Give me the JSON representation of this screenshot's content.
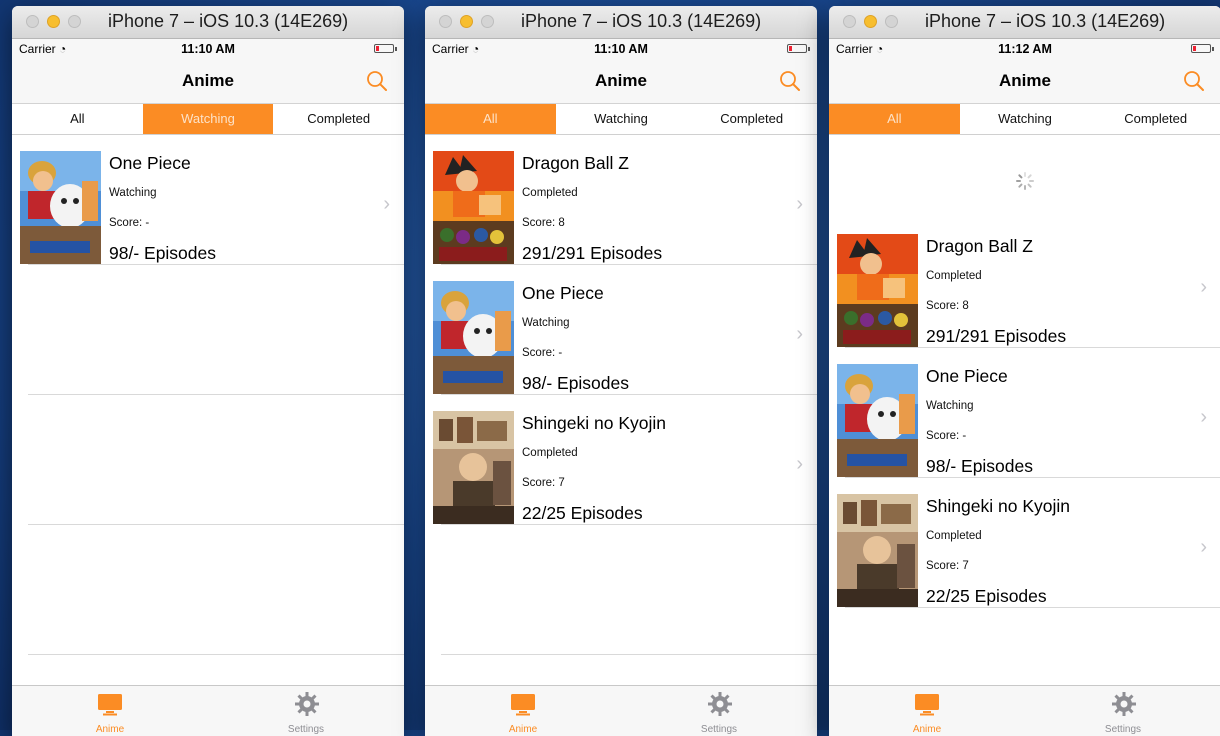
{
  "colors": {
    "accent": "#fb8c24",
    "chevron": "#c7c7cc"
  },
  "windows": [
    {
      "title": "iPhone 7 – iOS 10.3 (14E269)",
      "status": {
        "carrier": "Carrier",
        "time": "11:10 AM"
      },
      "nav_title": "Anime",
      "tabs": [
        "All",
        "Watching",
        "Completed"
      ],
      "active_tab": "Watching",
      "items": [
        {
          "title": "One Piece",
          "status": "Watching",
          "score": "Score: -",
          "episodes": "98/- Episodes",
          "cover": "one-piece"
        }
      ],
      "tabbar": {
        "anime": "Anime",
        "settings": "Settings"
      }
    },
    {
      "title": "iPhone 7 – iOS 10.3 (14E269)",
      "status": {
        "carrier": "Carrier",
        "time": "11:10 AM"
      },
      "nav_title": "Anime",
      "tabs": [
        "All",
        "Watching",
        "Completed"
      ],
      "active_tab": "All",
      "items": [
        {
          "title": "Dragon Ball Z",
          "status": "Completed",
          "score": "Score: 8",
          "episodes": "291/291 Episodes",
          "cover": "dbz"
        },
        {
          "title": "One Piece",
          "status": "Watching",
          "score": "Score: -",
          "episodes": "98/- Episodes",
          "cover": "one-piece"
        },
        {
          "title": "Shingeki no Kyojin",
          "status": "Completed",
          "score": "Score: 7",
          "episodes": "22/25 Episodes",
          "cover": "snk"
        }
      ],
      "tabbar": {
        "anime": "Anime",
        "settings": "Settings"
      }
    },
    {
      "title": "iPhone 7 – iOS 10.3 (14E269)",
      "status": {
        "carrier": "Carrier",
        "time": "11:12 AM"
      },
      "nav_title": "Anime",
      "tabs": [
        "All",
        "Watching",
        "Completed"
      ],
      "active_tab": "All",
      "loading": true,
      "items": [
        {
          "title": "Dragon Ball Z",
          "status": "Completed",
          "score": "Score: 8",
          "episodes": "291/291 Episodes",
          "cover": "dbz"
        },
        {
          "title": "One Piece",
          "status": "Watching",
          "score": "Score: -",
          "episodes": "98/- Episodes",
          "cover": "one-piece"
        },
        {
          "title": "Shingeki no Kyojin",
          "status": "Completed",
          "score": "Score: 7",
          "episodes": "22/25 Episodes",
          "cover": "snk"
        }
      ],
      "tabbar": {
        "anime": "Anime",
        "settings": "Settings"
      }
    }
  ]
}
